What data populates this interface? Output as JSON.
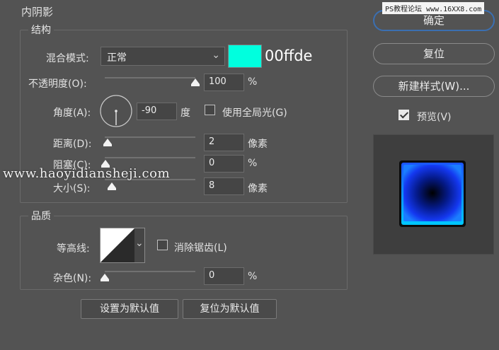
{
  "panel": {
    "title": "内阴影"
  },
  "structure": {
    "legend": "结构",
    "blend_mode_label": "混合模式:",
    "blend_mode_value": "正常",
    "color_swatch": "#00ffde",
    "color_hex_text": "00ffde",
    "opacity_label": "不透明度(O):",
    "opacity_value": "100",
    "opacity_unit": "%",
    "opacity_level": 1.0,
    "angle_label": "角度(A):",
    "angle_value": "-90",
    "angle_unit": "度",
    "global_light_label": "使用全局光(G)",
    "global_light_checked": false,
    "distance_label": "距离(D):",
    "distance_value": "2",
    "distance_unit": "像素",
    "choke_label": "阻塞(C):",
    "choke_value": "0",
    "choke_unit": "%",
    "size_label": "大小(S):",
    "size_value": "8",
    "size_unit": "像素"
  },
  "quality": {
    "legend": "品质",
    "contour_label": "等高线:",
    "anti_alias_label": "消除锯齿(L)",
    "anti_alias_checked": false,
    "noise_label": "杂色(N):",
    "noise_value": "0",
    "noise_unit": "%"
  },
  "defaults": {
    "set_default_label": "设置为默认值",
    "reset_default_label": "复位为默认值"
  },
  "actions": {
    "ok_label": "确定",
    "reset_label": "复位",
    "new_style_label": "新建样式(W)...",
    "preview_label": "预览(V)",
    "preview_checked": true
  },
  "overlays": {
    "watermark_text": "www.haoyidiansheji.com",
    "site_tag_text": "PS教程论坛 www.16XX8.com"
  },
  "colors": {
    "background": "#535353",
    "swatch": "#00ffde",
    "primary_button_border": "#3b6fb1",
    "preview_square_edge": "#1b7dff"
  }
}
